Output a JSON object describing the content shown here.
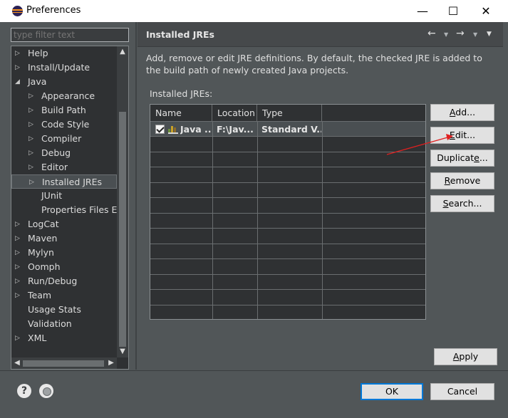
{
  "window": {
    "title": "Preferences",
    "minimize_glyph": "—",
    "maximize_glyph": "☐",
    "close_glyph": "✕"
  },
  "filter": {
    "placeholder": "type filter text"
  },
  "tree": {
    "items": [
      {
        "label": "Help",
        "level": 0,
        "expanded": false,
        "has_children": true
      },
      {
        "label": "Install/Update",
        "level": 0,
        "expanded": false,
        "has_children": true
      },
      {
        "label": "Java",
        "level": 0,
        "expanded": true,
        "has_children": true
      },
      {
        "label": "Appearance",
        "level": 1,
        "expanded": false,
        "has_children": true
      },
      {
        "label": "Build Path",
        "level": 1,
        "expanded": false,
        "has_children": true
      },
      {
        "label": "Code Style",
        "level": 1,
        "expanded": false,
        "has_children": true
      },
      {
        "label": "Compiler",
        "level": 1,
        "expanded": false,
        "has_children": true
      },
      {
        "label": "Debug",
        "level": 1,
        "expanded": false,
        "has_children": true
      },
      {
        "label": "Editor",
        "level": 1,
        "expanded": false,
        "has_children": true
      },
      {
        "label": "Installed JREs",
        "level": 1,
        "expanded": false,
        "has_children": true,
        "selected": true
      },
      {
        "label": "JUnit",
        "level": 1,
        "expanded": false,
        "has_children": false
      },
      {
        "label": "Properties Files Ed",
        "level": 1,
        "expanded": false,
        "has_children": false
      },
      {
        "label": "LogCat",
        "level": 0,
        "expanded": false,
        "has_children": true
      },
      {
        "label": "Maven",
        "level": 0,
        "expanded": false,
        "has_children": true
      },
      {
        "label": "Mylyn",
        "level": 0,
        "expanded": false,
        "has_children": true
      },
      {
        "label": "Oomph",
        "level": 0,
        "expanded": false,
        "has_children": true
      },
      {
        "label": "Run/Debug",
        "level": 0,
        "expanded": false,
        "has_children": true
      },
      {
        "label": "Team",
        "level": 0,
        "expanded": false,
        "has_children": true
      },
      {
        "label": "Usage Stats",
        "level": 0,
        "expanded": false,
        "has_children": false
      },
      {
        "label": "Validation",
        "level": 0,
        "expanded": false,
        "has_children": false
      },
      {
        "label": "XML",
        "level": 0,
        "expanded": false,
        "has_children": true
      }
    ]
  },
  "page": {
    "title": "Installed JREs",
    "description": "Add, remove or edit JRE definitions. By default, the checked JRE is added to the build path of newly created Java projects.",
    "list_label_prefix": "Installed ",
    "list_label_mnemonic": "J",
    "list_label_suffix": "REs:"
  },
  "table": {
    "columns": [
      "Name",
      "Location",
      "Type"
    ],
    "rows": [
      {
        "name": "Java ...",
        "location": "F:\\Jav...",
        "type": "Standard V...",
        "checked": true
      }
    ]
  },
  "side_buttons": [
    {
      "label": "Add...",
      "mnemonic_index": 0
    },
    {
      "label": "Edit...",
      "mnemonic_index": 0
    },
    {
      "label": "Duplicate...",
      "mnemonic_index": 8
    },
    {
      "label": "Remove",
      "mnemonic_index": 0
    },
    {
      "label": "Search...",
      "mnemonic_index": 0
    }
  ],
  "apply_button": {
    "label": "Apply",
    "mnemonic_index": 0
  },
  "ok_button": {
    "label": "OK"
  },
  "cancel_button": {
    "label": "Cancel"
  },
  "icons": {
    "back": "←",
    "forward": "→",
    "dropdown": "▼",
    "menu": "▼",
    "help": "?",
    "tree_collapsed": "▷",
    "tree_expanded": "◢",
    "scroll_up": "▲",
    "scroll_down": "▼",
    "scroll_left": "◀",
    "scroll_right": "▶"
  },
  "annotation": {
    "color": "#e02020"
  }
}
